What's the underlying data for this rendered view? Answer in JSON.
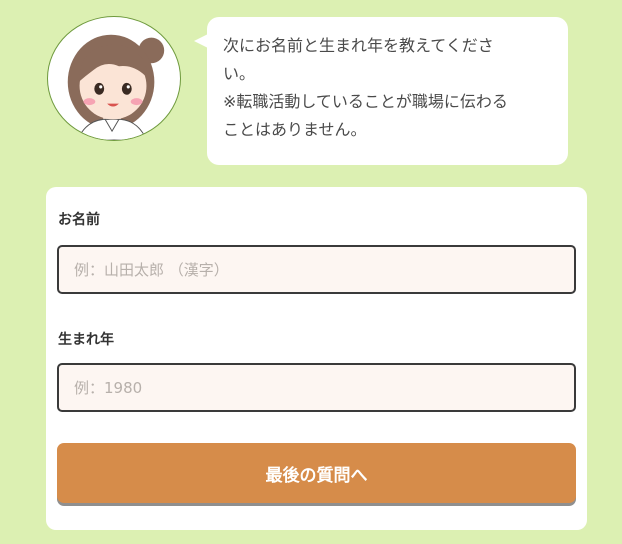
{
  "bubble": {
    "line1": "次にお名前と生まれ年を教えてくださ",
    "line2": "い。",
    "line3": "※転職活動していることが職場に伝わる",
    "line4": "ことはありません。"
  },
  "form": {
    "name_label": "お名前",
    "name_placeholder": "例：山田太郎 （漢字）",
    "name_value": "",
    "year_label": "生まれ年",
    "year_placeholder": "例：1980",
    "year_value": "",
    "submit_label": "最後の質問へ"
  },
  "colors": {
    "background": "#dcf0b2",
    "button": "#d68c4a",
    "input_background": "#fdf6f2"
  },
  "icons": {
    "avatar": "woman-avatar-icon"
  }
}
